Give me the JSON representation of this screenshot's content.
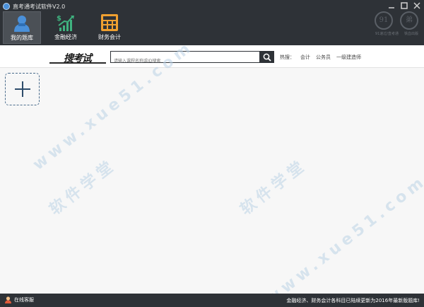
{
  "window": {
    "title": "直考通考试软件V2.0",
    "controls": [
      "minimize",
      "maximize",
      "close"
    ]
  },
  "nav": {
    "items": [
      {
        "label": "我的题库",
        "icon": "user-icon",
        "active": true
      },
      {
        "label": "金融经济",
        "icon": "dollar-chart-icon",
        "active": false
      },
      {
        "label": "财务会计",
        "icon": "calculator-icon",
        "active": false
      }
    ]
  },
  "brand": {
    "logo_left": "91",
    "logo_right": "弟",
    "caption_left": "91速过/直考通",
    "caption_right": "铁血出版"
  },
  "search": {
    "logo_text": "搜考试",
    "placeholder": "请输入课程名称或ID搜索",
    "hot_label": "热搜：",
    "hot_links": [
      "会计",
      "公务员",
      "一级建造师"
    ]
  },
  "watermark": {
    "text_1": "www.xue51.com",
    "text_2": "软件学堂",
    "text_3": "软件学堂",
    "text_4": "www.xue51.com"
  },
  "status": {
    "service_label": "在线客服",
    "notice": "金融经济、财务会计各科目已陆续更新为2016年最新版题库!"
  },
  "colors": {
    "dark_bar": "#2e3237",
    "icon_blue": "#4a90d9",
    "icon_green": "#3fb27f",
    "icon_orange": "#f0a030"
  }
}
